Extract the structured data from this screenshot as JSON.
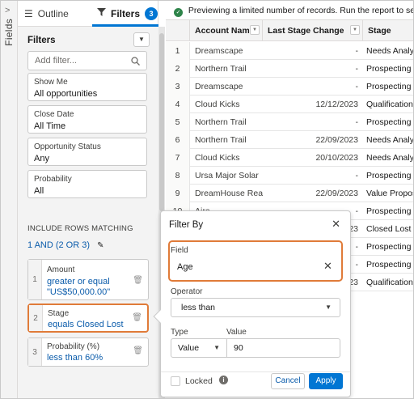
{
  "rail": {
    "label": "Fields",
    "chevron": ">"
  },
  "tabs": {
    "outline": "Outline",
    "filters": "Filters",
    "filters_count": "3"
  },
  "filters_panel": {
    "title": "Filters",
    "add_filter_placeholder": "Add filter...",
    "cards": [
      {
        "label": "Show Me",
        "value": "All opportunities"
      },
      {
        "label": "Close Date",
        "value": "All Time"
      },
      {
        "label": "Opportunity Status",
        "value": "Any"
      },
      {
        "label": "Probability",
        "value": "All"
      }
    ],
    "include_rows_label": "INCLUDE ROWS MATCHING",
    "logic": "1 AND (2 OR 3)",
    "rows": [
      {
        "num": "1",
        "label": "Amount",
        "value_line1": "greater or equal",
        "value_line2": "\"US$50,000.00\""
      },
      {
        "num": "2",
        "label": "Stage",
        "value_line1": "equals Closed Lost",
        "value_line2": ""
      },
      {
        "num": "3",
        "label": "Probability (%)",
        "value_line1": "less than 60%",
        "value_line2": ""
      }
    ]
  },
  "notice": "Previewing a limited number of records. Run the report to see everything.",
  "table": {
    "columns": [
      "Account Name",
      "Last Stage Change Date",
      "Stage"
    ],
    "rows": [
      {
        "n": "1",
        "account": "Dreamscape",
        "date": "-",
        "stage": "Needs Analysis"
      },
      {
        "n": "2",
        "account": "Northern Trail",
        "date": "-",
        "stage": "Prospecting"
      },
      {
        "n": "3",
        "account": "Dreamscape",
        "date": "-",
        "stage": "Prospecting"
      },
      {
        "n": "4",
        "account": "Cloud Kicks",
        "date": "12/12/2023",
        "stage": "Qualification"
      },
      {
        "n": "5",
        "account": "Northern Trail",
        "date": "-",
        "stage": "Prospecting"
      },
      {
        "n": "6",
        "account": "Northern Trail",
        "date": "22/09/2023",
        "stage": "Needs Analysis"
      },
      {
        "n": "7",
        "account": "Cloud Kicks",
        "date": "20/10/2023",
        "stage": "Needs Analysis"
      },
      {
        "n": "8",
        "account": "Ursa Major Solar",
        "date": "-",
        "stage": "Prospecting"
      },
      {
        "n": "9",
        "account": "DreamHouse Realty",
        "date": "22/09/2023",
        "stage": "Value Proposition"
      },
      {
        "n": "10",
        "account": "Aire...",
        "date": "-",
        "stage": "Prospecting"
      },
      {
        "n": "",
        "account": "",
        "date": "23",
        "stage": "Closed Lost"
      },
      {
        "n": "",
        "account": "",
        "date": "-",
        "stage": "Prospecting"
      },
      {
        "n": "",
        "account": "",
        "date": "-",
        "stage": "Prospecting"
      },
      {
        "n": "",
        "account": "",
        "date": "23",
        "stage": "Qualification"
      }
    ]
  },
  "popover": {
    "title": "Filter By",
    "field_label": "Field",
    "field_value": "Age",
    "operator_label": "Operator",
    "operator_value": "less than",
    "type_label": "Type",
    "type_value": "Value",
    "value_label": "Value",
    "value_value": "90",
    "locked_label": "Locked",
    "cancel_label": "Cancel",
    "apply_label": "Apply"
  },
  "colors": {
    "accent": "#0176d3",
    "highlight": "#e07b39",
    "success": "#2e844a"
  }
}
